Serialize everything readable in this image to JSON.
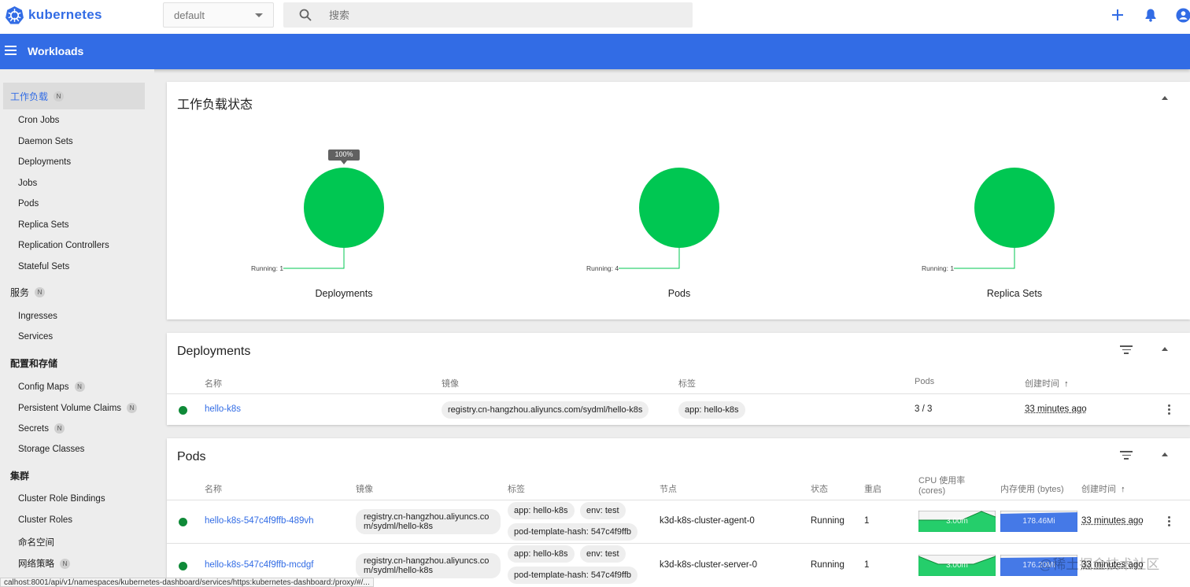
{
  "brand": {
    "name": "kubernetes",
    "color": "#326ce5"
  },
  "namespace": {
    "selected": "default"
  },
  "search": {
    "placeholder": "搜索"
  },
  "appbar": {
    "title": "Workloads"
  },
  "sidebar": {
    "badge": "N",
    "sections": [
      {
        "label": "工作负载",
        "items": [
          "Cron Jobs",
          "Daemon Sets",
          "Deployments",
          "Jobs",
          "Pods",
          "Replica Sets",
          "Replication Controllers",
          "Stateful Sets"
        ]
      },
      {
        "label": "服务",
        "items": [
          "Ingresses",
          "Services"
        ]
      },
      {
        "label": "配置和存储",
        "items": [
          "Config Maps",
          "Persistent Volume Claims",
          "Secrets",
          "Storage Classes"
        ]
      },
      {
        "label": "集群",
        "items": [
          "Cluster Role Bindings",
          "Cluster Roles",
          "命名空间",
          "网络策略"
        ]
      }
    ]
  },
  "workload_status": {
    "title": "工作负载状态",
    "tooltip": "100%",
    "charts": [
      {
        "label": "Deployments",
        "legend": "Running: 1"
      },
      {
        "label": "Pods",
        "legend": "Running: 4"
      },
      {
        "label": "Replica Sets",
        "legend": "Running: 1"
      }
    ]
  },
  "deployments": {
    "title": "Deployments",
    "columns": [
      "名称",
      "镜像",
      "标签",
      "Pods",
      "创建时间"
    ],
    "rows": [
      {
        "name": "hello-k8s",
        "image": "registry.cn-hangzhou.aliyuncs.com/sydml/hello-k8s",
        "label": "app: hello-k8s",
        "pods": "3 / 3",
        "created": "33 minutes ago"
      }
    ]
  },
  "pods": {
    "title": "Pods",
    "columns": {
      "name": "名称",
      "image": "镜像",
      "labels": "标签",
      "node": "节点",
      "status": "状态",
      "restarts": "重启",
      "cpu": "CPU 使用率",
      "cpu_unit": "(cores)",
      "mem": "内存使用 (bytes)",
      "created": "创建时间"
    },
    "rows": [
      {
        "name": "hello-k8s-547c4f9ffb-489vh",
        "image_l1": "registry.cn-hangzhou.aliyuncs.co",
        "image_l2": "m/sydml/hello-k8s",
        "label1": "app: hello-k8s",
        "label2": "env: test",
        "label3": "pod-template-hash: 547c4f9ffb",
        "node": "k3d-k8s-cluster-agent-0",
        "status": "Running",
        "restarts": "1",
        "cpu": "3.00m",
        "mem": "178.46Mi",
        "created": "33 minutes ago"
      },
      {
        "name": "hello-k8s-547c4f9ffb-mcdgf",
        "image_l1": "registry.cn-hangzhou.aliyuncs.co",
        "image_l2": "m/sydml/hello-k8s",
        "label1": "app: hello-k8s",
        "label2": "env: test",
        "label3": "pod-template-hash: 547c4f9ffb",
        "node": "k3d-k8s-cluster-server-0",
        "status": "Running",
        "restarts": "1",
        "cpu": "3.00m",
        "mem": "176.20Mi",
        "created": "33 minutes ago"
      }
    ]
  },
  "colors": {
    "running": "#00c752",
    "status_dot": "#0f8a38",
    "cpu_fill": "#00c752",
    "mem_fill": "#326ce5"
  },
  "statusbar": "calhost:8001/api/v1/namespaces/kubernetes-dashboard/services/https:kubernetes-dashboard:/proxy/#/...",
  "watermark": "@稀土掘金技术社区"
}
